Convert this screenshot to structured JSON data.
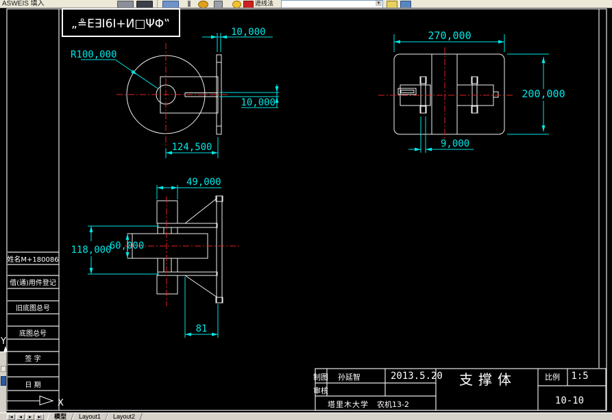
{
  "toolbar": {
    "fragment": "ASWEIS 填入",
    "mode_label": "遮线法",
    "combo_value": ""
  },
  "stamp_text": "„≗E∃I6I+И□ΨΦ‟",
  "dims": {
    "r": "R100,000",
    "flange10": "10,000",
    "slot10": "10,000",
    "w124": "124,500",
    "w270": "270,000",
    "h200": "200,000",
    "p9": "9,000",
    "w49": "49,000",
    "h118": "118,000",
    "h60": "60,000",
    "g81": "81"
  },
  "left_strip": {
    "rows": [
      "姓名M+180086",
      "借(通)用件登记",
      "旧底图总号",
      "底图总号",
      "签  字",
      "日  期"
    ]
  },
  "ucs": {
    "x": "X",
    "y": "Y"
  },
  "title_block": {
    "draw_label": "制图",
    "drafter": "孙延智",
    "date": "2013.5.20",
    "check_label": "审核",
    "part_name": "支撑体",
    "scale_label": "比例",
    "scale_value": "1:5",
    "drawing_no": "10-10",
    "school": "塔里木大学",
    "class_name": "农机13-2"
  },
  "tabs": {
    "nav": [
      "|◀",
      "◀",
      "▶",
      "▶|"
    ],
    "model": "模型",
    "l1": "Layout1",
    "l2": "Layout2"
  }
}
